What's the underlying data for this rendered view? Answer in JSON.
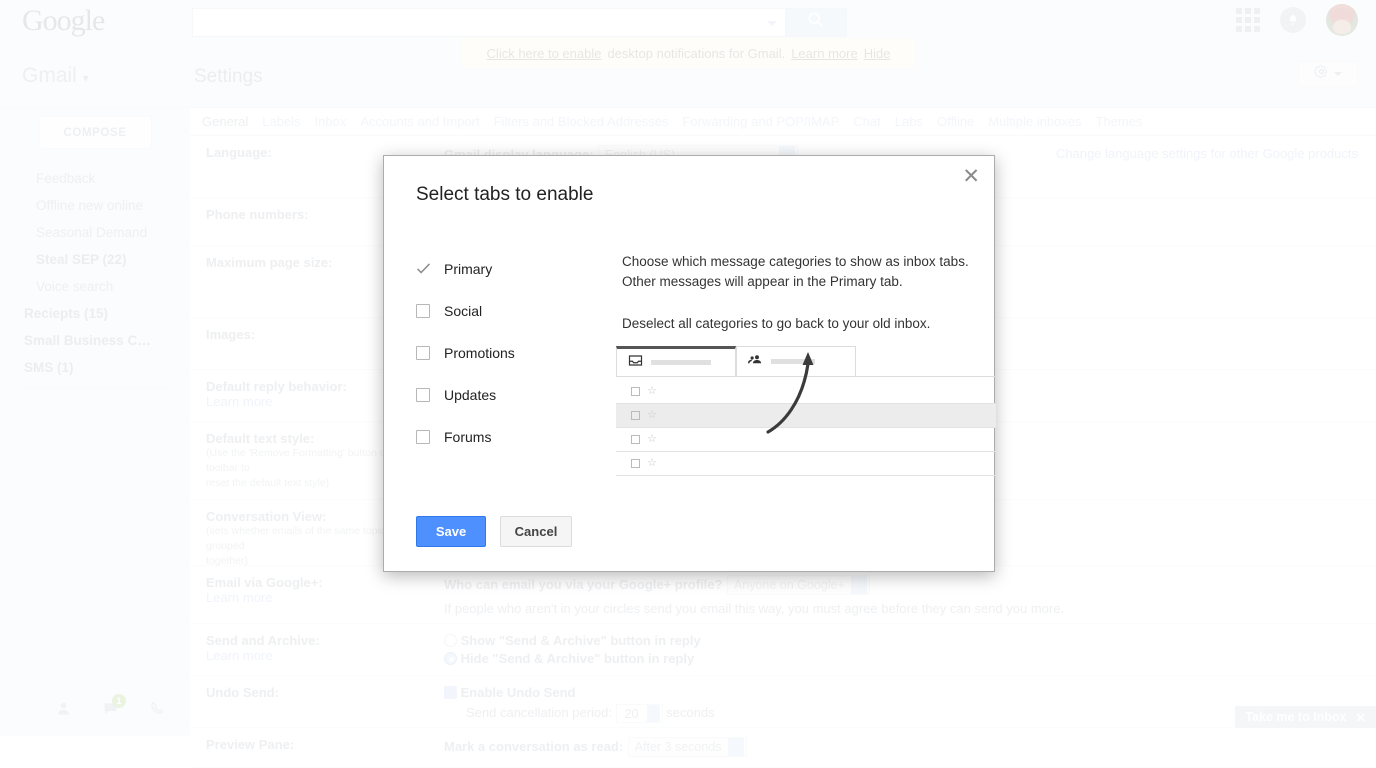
{
  "google_bar": {
    "logo": "Google",
    "search_value": "",
    "search_placeholder": "",
    "search_icon": "search-icon",
    "apps_icon": "apps-grid-icon",
    "notifications_icon": "bell-icon",
    "avatar": "user-avatar"
  },
  "notification_strip": {
    "link": "Click here to enable",
    "text": "desktop notifications for Gmail.",
    "learn_more": "Learn more",
    "hide": "Hide"
  },
  "gmail_header": {
    "brand": "Gmail",
    "brand_caret": "▾",
    "page_title": "Settings",
    "gear_icon": "gear-icon"
  },
  "sidebar": {
    "compose": "COMPOSE",
    "items": [
      {
        "label": "Feedback",
        "bold": false,
        "indent": true
      },
      {
        "label": "Offline new online",
        "bold": false,
        "indent": true
      },
      {
        "label": "Seasonal Demand",
        "bold": false,
        "indent": true
      },
      {
        "label": "Steal SEP (22)",
        "bold": true,
        "indent": true
      },
      {
        "label": "Voice search",
        "bold": false,
        "indent": true
      },
      {
        "label": "Reciepts (15)",
        "bold": true,
        "indent": false
      },
      {
        "label": "Small Business C…",
        "bold": true,
        "indent": false
      },
      {
        "label": "SMS (1)",
        "bold": true,
        "indent": false
      }
    ],
    "footer_icons": [
      "person-icon",
      "chat-icon",
      "phone-icon"
    ],
    "chat_badge": "1"
  },
  "settings_tabs": [
    {
      "label": "General",
      "active": true
    },
    {
      "label": "Labels",
      "active": false
    },
    {
      "label": "Inbox",
      "active": false
    },
    {
      "label": "Accounts and Import",
      "active": false
    },
    {
      "label": "Filters and Blocked Addresses",
      "active": false
    },
    {
      "label": "Forwarding and POP/IMAP",
      "active": false
    },
    {
      "label": "Chat",
      "active": false
    },
    {
      "label": "Labs",
      "active": false
    },
    {
      "label": "Offline",
      "active": false
    },
    {
      "label": "Multiple inboxes",
      "active": false
    },
    {
      "label": "Themes",
      "active": false
    }
  ],
  "settings_rows": {
    "language_label": "Language:",
    "language_field_label": "Gmail display language:",
    "language_value": "English (US)",
    "language_change_link": "Change language settings for other Google products",
    "phone_label": "Phone numbers:",
    "max_page_label": "Maximum page size:",
    "images_label": "Images:",
    "default_reply_label": "Default reply behavior:",
    "default_reply_learn": "Learn more",
    "default_text_label": "Default text style:",
    "default_text_hint_1": "(Use the 'Remove Formatting' button on the toolbar to",
    "default_text_hint_2": "reset the default text style)",
    "conversation_label": "Conversation View:",
    "conversation_hint_1": "(sets whether emails of the same topic are grouped",
    "conversation_hint_2": "together)",
    "googleplus_label": "Email via Google+:",
    "googleplus_learn": "Learn more",
    "googleplus_question": "Who can email you via your Google+ profile?",
    "googleplus_value": "Anyone on Google+",
    "googleplus_note": "If people who aren't in your circles send you email this way, you must agree before they can send you more.",
    "send_archive_label": "Send and Archive:",
    "send_archive_learn": "Learn more",
    "send_archive_show": "Show \"Send & Archive\" button in reply",
    "send_archive_hide": "Hide \"Send & Archive\" button in reply",
    "undo_label": "Undo Send:",
    "undo_enable": "Enable Undo Send",
    "undo_period_label": "Send cancellation period:",
    "undo_period_value": "20",
    "undo_period_units": "seconds",
    "preview_label": "Preview Pane:",
    "preview_mark_label": "Mark a conversation as read:",
    "preview_mark_value": "After 3 seconds"
  },
  "inbox_badge": {
    "label": "Take me to Inbox",
    "close_icon": "close-icon"
  },
  "modal": {
    "title": "Select tabs to enable",
    "close_icon": "close-icon",
    "options": [
      {
        "label": "Primary",
        "checked": true
      },
      {
        "label": "Social",
        "checked": false
      },
      {
        "label": "Promotions",
        "checked": false
      },
      {
        "label": "Updates",
        "checked": false
      },
      {
        "label": "Forums",
        "checked": false
      }
    ],
    "description_1": "Choose which message categories to show as inbox tabs. Other messages will appear in the Primary tab.",
    "description_2": "Deselect all categories to go back to your old inbox.",
    "illustration": {
      "tab_primary_icon": "inbox-icon",
      "tab_social_icon": "people-icon",
      "arrow": "curved-arrow-up"
    },
    "save_label": "Save",
    "cancel_label": "Cancel",
    "accent_color": "#4d90fe"
  }
}
